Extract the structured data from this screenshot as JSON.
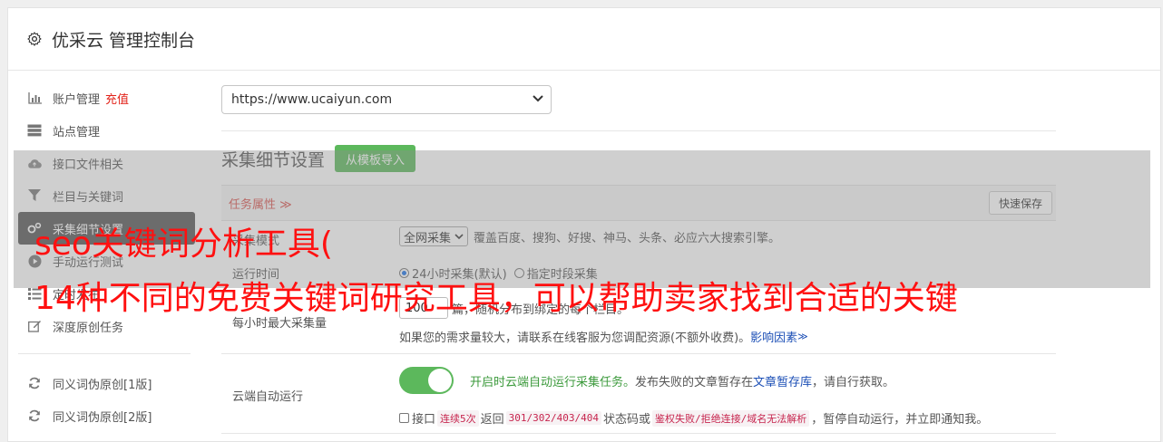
{
  "header": {
    "title": "优采云 管理控制台",
    "icon": "gear-icon"
  },
  "sidebar": {
    "items": [
      {
        "label": "账户管理",
        "extra": "充值",
        "icon": "bar-chart-icon"
      },
      {
        "label": "站点管理",
        "icon": "server-icon"
      },
      {
        "label": "接口文件相关",
        "icon": "cloud-upload-icon"
      },
      {
        "label": "栏目与关键词",
        "icon": "filter-icon"
      },
      {
        "label": "采集细节设置",
        "icon": "gears-icon"
      },
      {
        "label": "手动运行测试",
        "icon": "play-circle-icon"
      },
      {
        "label": "定时发布",
        "icon": "list-icon"
      },
      {
        "label": "深度原创任务",
        "icon": "edit-icon"
      }
    ],
    "items2": [
      {
        "label": "同义词伪原创[1版]",
        "icon": "refresh-icon"
      },
      {
        "label": "同义词伪原创[2版]",
        "icon": "refresh-icon"
      }
    ]
  },
  "main": {
    "site_select": "https://www.ucaiyun.com",
    "section_title": "采集细节设置",
    "import_button": "从模板导入",
    "tab_label": "任务属性 ≫",
    "quick_save": "快速保存",
    "rows": {
      "collect_mode_label": "采集模式",
      "collect_mode_select": "全网采集",
      "collect_mode_desc": "覆盖百度、搜狗、好搜、神马、头条、必应六大搜索引擎。",
      "run_time_label": "运行时间",
      "run_time_opt1": "24小时采集(默认)",
      "run_time_opt2": "指定时段采集",
      "max_per_hour_label": "每小时最大采集量",
      "max_per_hour_value": "100",
      "max_per_hour_desc": "篇，随机分布到绑定的每个栏目。",
      "max_per_hour_note": "如果您的需求量较大，请联系在线客服为您调配资源(不额外收费)。",
      "max_per_hour_link": "影响因素",
      "cloud_label": "云端自动运行",
      "cloud_desc_green": "开启时云端自动运行采集任务。",
      "cloud_desc_1": "发布失败的文章暂存在",
      "cloud_desc_link": "文章暂存库",
      "cloud_desc_2": "，请自行获取。",
      "iface_text_1": "接口",
      "iface_code_1": "连续5次",
      "iface_text_2": "返回",
      "iface_code_2": "301/302/403/404",
      "iface_text_3": "状态码或",
      "iface_code_3": "鉴权失败/拒绝连接/域名无法解析",
      "iface_text_4": "，暂停自动运行，并立即通知我。"
    }
  },
  "watermark": {
    "line1": "seo关键词分析工具(",
    "line2": "14种不同的免费关键词研究工具，可以帮助卖家找到合适的关键"
  },
  "colors": {
    "accent_green": "#5cb85c",
    "watermark_red": "#ff1010",
    "tab_red": "#d9534f",
    "link_blue": "#1c4fb6"
  }
}
